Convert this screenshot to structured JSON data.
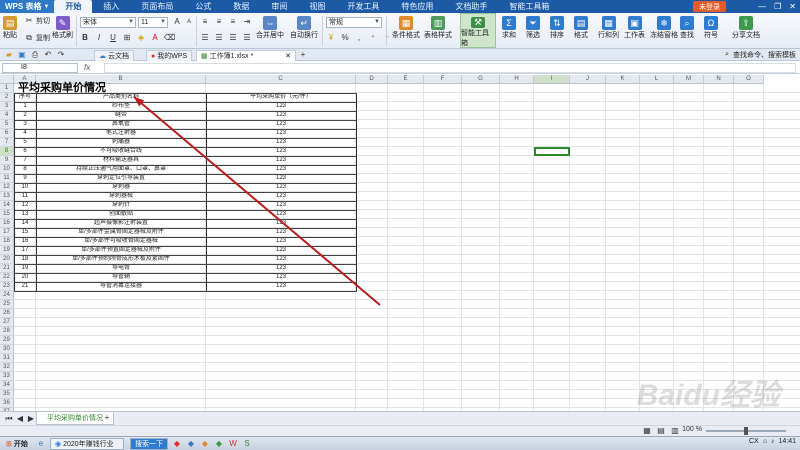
{
  "app": {
    "name": "WPS 表格",
    "login": "未登录"
  },
  "menu": [
    "开始",
    "插入",
    "页面布局",
    "公式",
    "数据",
    "审阅",
    "视图",
    "开发工具",
    "特色应用",
    "文档助手",
    "智能工具箱"
  ],
  "ribbon": {
    "cut": "剪切",
    "paste": "粘贴",
    "copy": "复制",
    "format_brush": "格式刷",
    "font": "宋体",
    "font_size": "11",
    "number_format": "常规",
    "merge": "合并居中",
    "wrap": "自动换行",
    "cond_format": "条件格式",
    "table_style": "表格样式",
    "smart_toolbox": "智能工具箱",
    "sum": "求和",
    "filter": "筛选",
    "sort": "排序",
    "fmt": "格式",
    "rows_cols": "行和列",
    "worksheet": "工作表",
    "freeze": "冻结窗格",
    "find": "查找",
    "symbol": "符号",
    "share": "分享文档",
    "percent": "%"
  },
  "tabs": [
    {
      "label": "云文档"
    },
    {
      "label": "我的WPS"
    },
    {
      "label": "工作簿1.xlsx *"
    }
  ],
  "tools_right": "查找命令、搜索模板",
  "formula_bar": {
    "name_box": "I8",
    "fx": "fx"
  },
  "columns": [
    "A",
    "B",
    "C",
    "D",
    "E",
    "F",
    "G",
    "H",
    "I",
    "J",
    "K",
    "L",
    "M",
    "N",
    "O"
  ],
  "rows": [
    "1",
    "2",
    "3",
    "4",
    "5",
    "6",
    "7",
    "8",
    "9",
    "10",
    "11",
    "12",
    "13",
    "14",
    "15",
    "16",
    "17",
    "18",
    "19",
    "20",
    "21",
    "22",
    "23",
    "24",
    "25",
    "26",
    "27",
    "28",
    "29",
    "30",
    "31",
    "32",
    "33",
    "34",
    "35",
    "36",
    "37"
  ],
  "sheet": {
    "title": "平均采购单价情况",
    "headers": [
      "序号",
      "产品类别名称",
      "平均采购单价（元/件）"
    ],
    "rows": [
      [
        "1",
        "纱布垫",
        "123"
      ],
      [
        "2",
        "缝带",
        "123"
      ],
      [
        "3",
        "鼻氧管",
        "123"
      ],
      [
        "4",
        "笔式注射器",
        "123"
      ],
      [
        "5",
        "刺痛器",
        "123"
      ],
      [
        "6",
        "不可吸收缝合线",
        "123"
      ],
      [
        "7",
        "材料输送器具",
        "123"
      ],
      [
        "8",
        "持续正压通气用面罩、口罩、鼻罩",
        "123"
      ],
      [
        "9",
        "穿刺定位引导装置",
        "123"
      ],
      [
        "10",
        "穿刺器",
        "123"
      ],
      [
        "11",
        "穿刺器械",
        "123"
      ],
      [
        "12",
        "穿刺针",
        "123"
      ],
      [
        "13",
        "创面敷贴",
        "123"
      ],
      [
        "14",
        "超声摄像影注射装置",
        "123"
      ],
      [
        "15",
        "单/多部件金属骨固定器械及附件",
        "123"
      ],
      [
        "16",
        "单/多部件可吸收骨固定器械",
        "123"
      ],
      [
        "17",
        "单/多部件预置固定器械及附件",
        "123"
      ],
      [
        "18",
        "单/多部件预制颅骨成形术板及紧固件",
        "123"
      ],
      [
        "19",
        "导电膏",
        "123"
      ],
      [
        "20",
        "导管鞘",
        "123"
      ],
      [
        "21",
        "导管消毒连接器",
        "123"
      ]
    ]
  },
  "sheet_tab": "平均采购单价情况",
  "status": {
    "zoom": "100 %",
    "zoom_value": 100
  },
  "taskbar": {
    "start": "开始",
    "items": [
      "2020年赚钱行业",
      "搜索一下"
    ],
    "ime": "CX",
    "clock": "14:41"
  },
  "watermark": "Baidu经验",
  "colors": {
    "accent": "#1d5aa6",
    "selection": "#2f8a2f",
    "arrow": "#b81e1e",
    "login": "#e35b28"
  }
}
